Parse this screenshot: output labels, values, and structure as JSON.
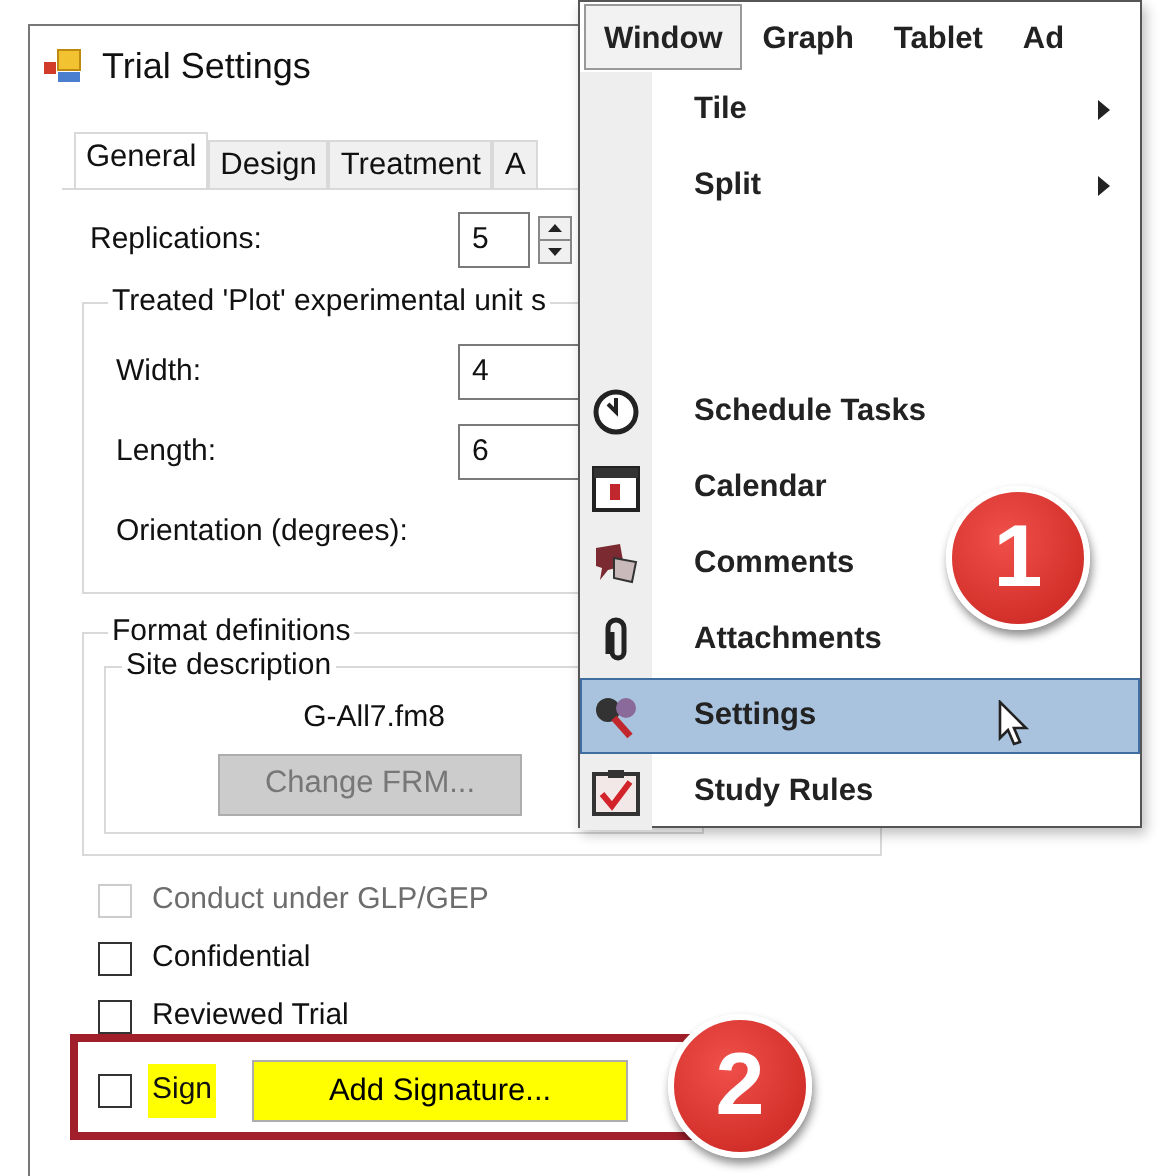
{
  "dialog": {
    "title": "Trial Settings",
    "tabs": [
      {
        "label": "General",
        "selected": true
      },
      {
        "label": "Design",
        "selected": false
      },
      {
        "label": "Treatment",
        "selected": false
      },
      {
        "label": "A",
        "selected": false
      }
    ],
    "replications": {
      "label": "Replications:",
      "value": "5"
    },
    "plot_group": {
      "title": "Treated 'Plot' experimental unit s",
      "fields": [
        {
          "label": "Width:",
          "value": "4"
        },
        {
          "label": "Length:",
          "value": "6"
        },
        {
          "label": "Orientation (degrees):"
        }
      ]
    },
    "format_group": {
      "title": "Format definitions",
      "site_group": {
        "title": "Site description",
        "file": "G-All7.fm8",
        "button": {
          "label": "Change FRM...",
          "disabled": true
        }
      }
    },
    "checkboxes": [
      {
        "label": "Conduct under GLP/GEP",
        "checked": false,
        "disabled": true,
        "highlighted": false
      },
      {
        "label": "Confidential",
        "checked": false,
        "disabled": false,
        "highlighted": false
      },
      {
        "label": "Reviewed Trial",
        "checked": false,
        "disabled": false,
        "highlighted": false
      },
      {
        "label": "Sign",
        "checked": false,
        "disabled": false,
        "highlighted": true
      }
    ],
    "signature_button": {
      "label": "Add Signature...",
      "highlighted": true
    }
  },
  "menu": {
    "menubar": [
      {
        "label": "Window",
        "selected": true
      },
      {
        "label": "Graph",
        "selected": false
      },
      {
        "label": "Tablet",
        "selected": false
      },
      {
        "label": "Ad",
        "selected": false
      }
    ],
    "items": [
      {
        "label": "Tile",
        "submenu": true,
        "selected": false
      },
      {
        "label": "Split",
        "submenu": true,
        "selected": false
      },
      {
        "kind": "gap"
      },
      {
        "label": "Schedule Tasks",
        "submenu": false,
        "selected": false
      },
      {
        "label": "Calendar",
        "submenu": false,
        "selected": false
      },
      {
        "label": "Comments",
        "submenu": false,
        "selected": false
      },
      {
        "label": "Attachments",
        "submenu": false,
        "selected": false
      },
      {
        "label": "Settings",
        "submenu": false,
        "selected": true
      },
      {
        "label": "Study Rules",
        "submenu": false,
        "selected": false
      }
    ]
  },
  "callouts": [
    "1",
    "2"
  ]
}
